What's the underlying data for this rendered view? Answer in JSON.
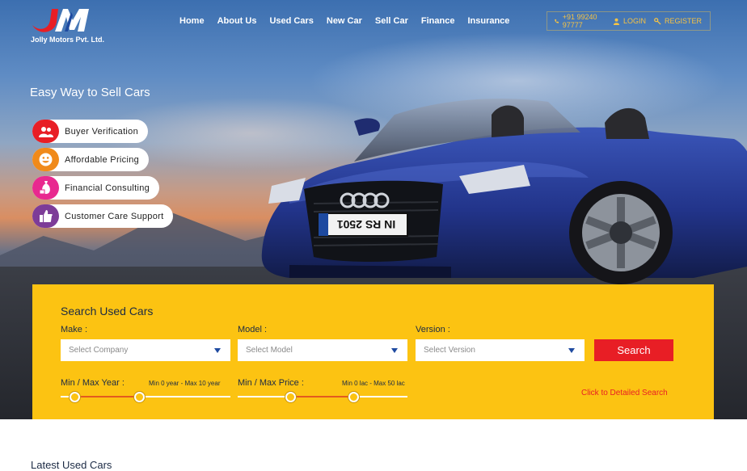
{
  "brand": {
    "name": "Jolly Motors Pvt. Ltd.",
    "mark_color": "#e81e25",
    "mark_color_2": "#1e4aa0"
  },
  "nav": {
    "items": [
      {
        "label": "Home"
      },
      {
        "label": "About Us"
      },
      {
        "label": "Used Cars"
      },
      {
        "label": "New Car"
      },
      {
        "label": "Sell Car"
      },
      {
        "label": "Finance"
      },
      {
        "label": "Insurance"
      }
    ]
  },
  "topbar": {
    "phone": "+91 99240 97777",
    "login": "LOGIN",
    "register": "REGISTER",
    "phone_icon": "phone-icon",
    "login_icon": "user-icon",
    "register_icon": "key-icon"
  },
  "hero": {
    "headline": "Easy Way to Sell Cars",
    "plate_text": "IN RS 2501",
    "features": [
      {
        "label": "Buyer Verification",
        "icon": "users-icon",
        "color": "#e81e25"
      },
      {
        "label": "Affordable Pricing",
        "icon": "smiley-icon",
        "color": "#f08a1b"
      },
      {
        "label": "Financial Consulting",
        "icon": "money-icon",
        "color": "#e8298f"
      },
      {
        "label": "Customer Care Support",
        "icon": "thumbs-up-icon",
        "color": "#7d3c98"
      }
    ]
  },
  "search": {
    "title": "Search Used Cars",
    "make_label": "Make :",
    "make_placeholder": "Select Company",
    "model_label": "Model :",
    "model_placeholder": "Select Model",
    "version_label": "Version :",
    "version_placeholder": "Select Version",
    "button": "Search",
    "year_label": "Min / Max Year :",
    "year_info": "Min 0 year - Max 10 year",
    "price_label": "Min / Max Price :",
    "price_info": "Min 0 lac - Max 50 lac",
    "detail_link": "Click to Detailed Search",
    "accent": "#fcc312",
    "button_color": "#e81e25"
  },
  "below_title": "Latest Used Cars"
}
